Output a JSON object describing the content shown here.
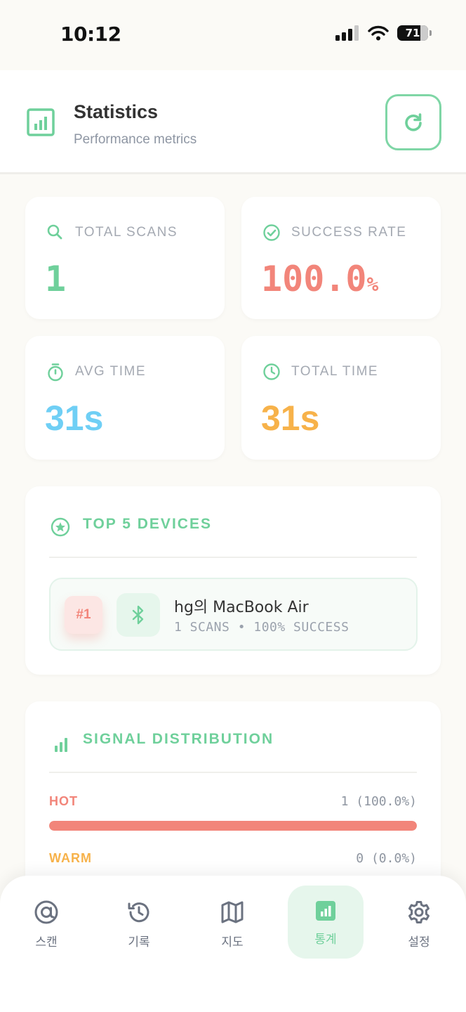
{
  "status": {
    "time": "10:12",
    "battery": "71"
  },
  "header": {
    "title": "Statistics",
    "subtitle": "Performance metrics"
  },
  "stats": [
    {
      "label": "TOTAL SCANS",
      "value": "1",
      "unit": "",
      "color": "#6FD09B",
      "icon": "search-icon"
    },
    {
      "label": "SUCCESS RATE",
      "value": "100.0",
      "unit": "%",
      "color": "#F2857A",
      "icon": "check-circle-icon"
    },
    {
      "label": "AVG TIME",
      "value": "31s",
      "unit": "",
      "color": "#6FCFF5",
      "icon": "stopwatch-icon"
    },
    {
      "label": "TOTAL TIME",
      "value": "31s",
      "unit": "",
      "color": "#F7B24A",
      "icon": "clock-icon"
    }
  ],
  "top_devices": {
    "title": "TOP 5 DEVICES",
    "items": [
      {
        "rank": "#1",
        "name": "hg의 MacBook Air",
        "meta": "1 SCANS • 100% SUCCESS"
      }
    ]
  },
  "signal": {
    "title": "SIGNAL DISTRIBUTION",
    "rows": [
      {
        "label": "HOT",
        "value": "1 (100.0%)",
        "fraction": 1.0,
        "color": "#F2857A"
      },
      {
        "label": "WARM",
        "value": "0 (0.0%)",
        "fraction": 0.0,
        "color": "#F7B24A"
      }
    ]
  },
  "tabs": [
    {
      "label": "스캔",
      "icon": "at-sign-icon",
      "active": false
    },
    {
      "label": "기록",
      "icon": "history-icon",
      "active": false
    },
    {
      "label": "지도",
      "icon": "map-icon",
      "active": false
    },
    {
      "label": "통계",
      "icon": "bar-chart-icon",
      "active": true
    },
    {
      "label": "설정",
      "icon": "gear-icon",
      "active": false
    }
  ],
  "colors": {
    "accent": "#6FD09B",
    "bg": "#FBFAF6"
  }
}
